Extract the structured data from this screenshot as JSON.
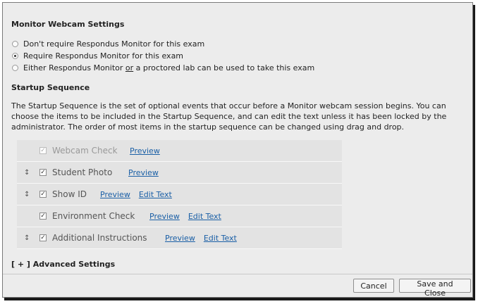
{
  "monitor": {
    "title": "Monitor Webcam Settings",
    "options": [
      {
        "label": "Don't require Respondus Monitor for this exam",
        "checked": false
      },
      {
        "label": "Require Respondus Monitor for this exam",
        "checked": true
      },
      {
        "label_pre": "Either Respondus Monitor ",
        "label_u": "or",
        "label_post": " a proctored lab can be used to take this exam",
        "checked": false
      }
    ]
  },
  "startup": {
    "title": "Startup Sequence",
    "description": "The Startup Sequence is the set of optional events that occur before a Monitor webcam session begins. You can choose the items to be included in the Startup Sequence, and can edit the text unless it has been locked by the administrator.  The order of most items in the startup sequence can be changed using drag and drop.",
    "items": [
      {
        "label": "Webcam Check",
        "preview": "Preview",
        "edit": ""
      },
      {
        "label": "Student Photo",
        "preview": "Preview",
        "edit": ""
      },
      {
        "label": "Show ID",
        "preview": "Preview",
        "edit": "Edit Text"
      },
      {
        "label": "Environment Check",
        "preview": "Preview",
        "edit": "Edit Text"
      },
      {
        "label": "Additional Instructions",
        "preview": "Preview",
        "edit": "Edit Text"
      }
    ],
    "grip_glyph": "↕",
    "check_glyph": "✓"
  },
  "advanced": {
    "label": "[ + ] Advanced Settings"
  },
  "footer": {
    "cancel": "Cancel",
    "save": "Save and Close"
  }
}
